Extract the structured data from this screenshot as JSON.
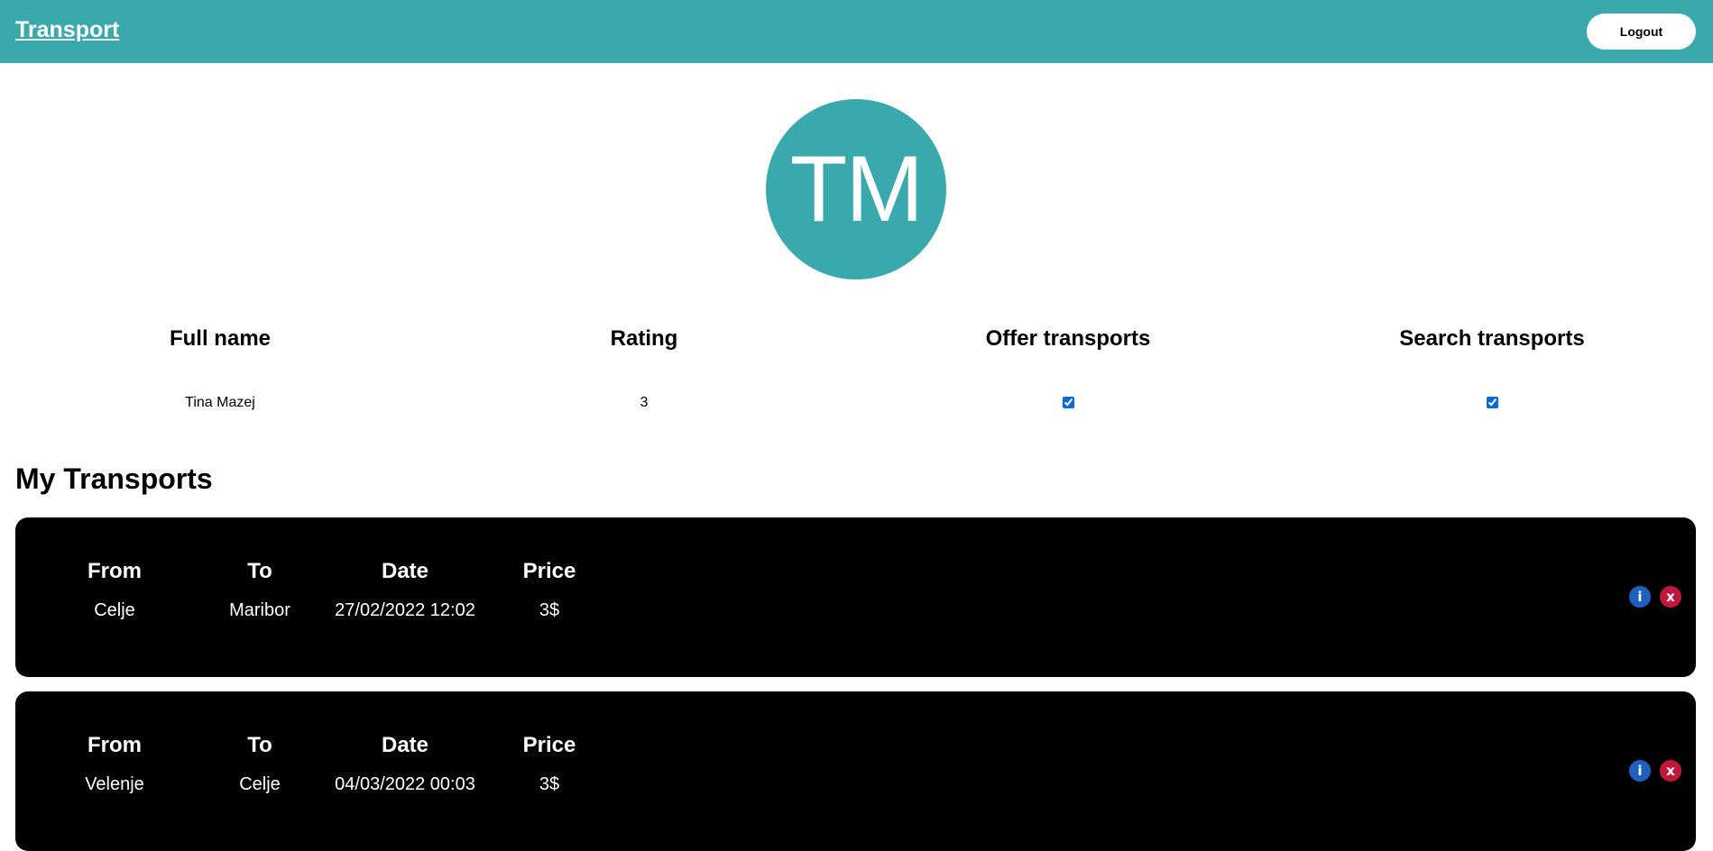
{
  "navbar": {
    "brand": "Transport",
    "logout_label": "Logout",
    "color": "#3aa9ad"
  },
  "profile": {
    "initials": "TM",
    "columns": {
      "full_name": "Full name",
      "rating": "Rating",
      "offer": "Offer transports",
      "search": "Search transports"
    },
    "values": {
      "full_name": "Tina Mazej",
      "rating": "3",
      "offer_checked": true,
      "search_checked": true
    }
  },
  "transports_section": {
    "title": "My Transports",
    "headers": {
      "from": "From",
      "to": "To",
      "date": "Date",
      "price": "Price"
    },
    "items": [
      {
        "from": "Celje",
        "to": "Maribor",
        "date": "27/02/2022 12:02",
        "price": "3$",
        "info_label": "i",
        "delete_label": "x"
      },
      {
        "from": "Velenje",
        "to": "Celje",
        "date": "04/03/2022 00:03",
        "price": "3$",
        "info_label": "i",
        "delete_label": "x"
      }
    ]
  },
  "colors": {
    "info": "#1f5fbf",
    "delete": "#c0183a"
  }
}
